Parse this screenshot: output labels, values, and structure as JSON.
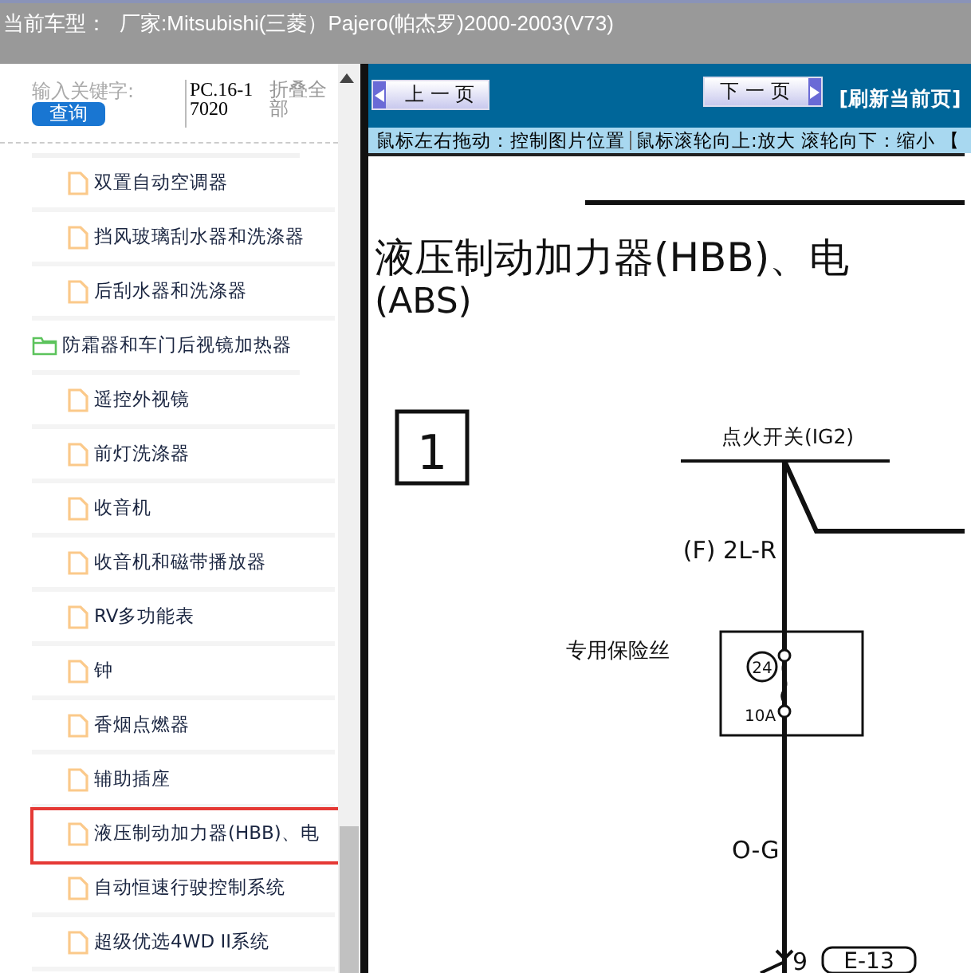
{
  "header": {
    "label": "当前车型：",
    "vehicle": "厂家:Mitsubishi(三菱）Pajero(帕杰罗)2000-2003(V73)"
  },
  "search": {
    "placeholder": "输入关键字:",
    "button": "查询",
    "code": "PC.16-17020",
    "collapse": "折叠全部"
  },
  "tree": [
    {
      "kind": "page",
      "label": "双置自动空调器",
      "selected": false
    },
    {
      "kind": "page",
      "label": "挡风玻璃刮水器和洗涤器",
      "selected": false
    },
    {
      "kind": "page",
      "label": "后刮水器和洗涤器",
      "selected": false
    },
    {
      "kind": "folder",
      "label": "防霜器和车门后视镜加热器",
      "expanded": true,
      "children": [
        {
          "kind": "page",
          "label": "遥控外视镜",
          "selected": false
        },
        {
          "kind": "page",
          "label": "前灯洗涤器",
          "selected": false
        },
        {
          "kind": "page",
          "label": "收音机",
          "selected": false
        },
        {
          "kind": "page",
          "label": "收音机和磁带播放器",
          "selected": false
        },
        {
          "kind": "page",
          "label": "RV多功能表",
          "selected": false
        },
        {
          "kind": "page",
          "label": "钟",
          "selected": false
        },
        {
          "kind": "page",
          "label": "香烟点燃器",
          "selected": false
        },
        {
          "kind": "page",
          "label": "辅助插座",
          "selected": false
        },
        {
          "kind": "page",
          "label": "液压制动加力器(HBB)、电",
          "selected": true
        },
        {
          "kind": "page",
          "label": "自动恒速行驶控制系统",
          "selected": false
        },
        {
          "kind": "page",
          "label": "超级优选4WD II系统",
          "selected": false
        }
      ]
    }
  ],
  "viewer": {
    "prev": "上 一 页",
    "next": "下 一 页",
    "refresh": "[刷新当前页]",
    "hints": [
      "鼠标左右拖动：控制图片位置",
      "鼠标滚轮向上:放大  滚轮向下：缩小 【"
    ]
  },
  "diagram": {
    "title": "液压制动加力器(HBB)、电",
    "subtitle": "(ABS)",
    "box_number": "1",
    "switch_label": "点火开关(IG2)",
    "wire_top": "(F) 2L-R",
    "fuse_label": "专用保险丝",
    "fuse_number": "24",
    "fuse_rating": "10A",
    "wire_bottom": "O-G",
    "pin": "9",
    "connector": "E-13"
  }
}
